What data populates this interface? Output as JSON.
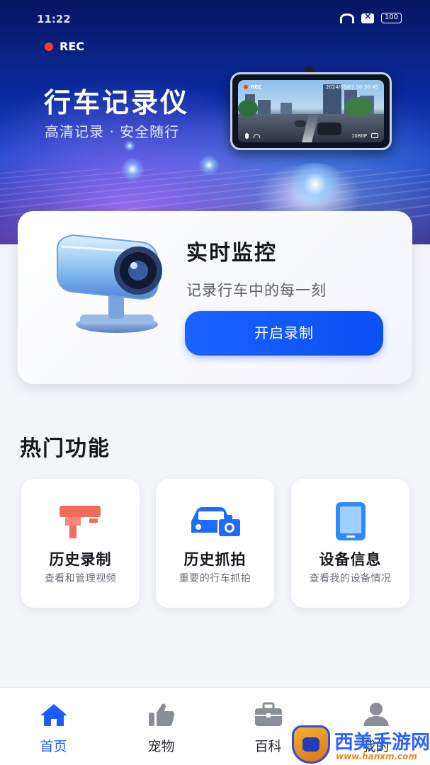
{
  "status_bar": {
    "time": "11:22",
    "battery": "100"
  },
  "hero": {
    "rec_label": "REC",
    "title": "行车记录仪",
    "subtitle": "高清记录 · 安全随行",
    "device_screen": {
      "rec_label": "REC",
      "datetime": "2024/06/01  10:30:45",
      "resolution": "1080P"
    }
  },
  "monitor_card": {
    "title": "实时监控",
    "description": "记录行车中的每一刻",
    "button_label": "开启录制"
  },
  "hot_features": {
    "title": "热门功能",
    "items": [
      {
        "name": "历史录制",
        "desc": "查看和管理视频",
        "icon": "cctv-camera-icon"
      },
      {
        "name": "历史抓拍",
        "desc": "重要的行车抓拍",
        "icon": "car-camera-icon"
      },
      {
        "name": "设备信息",
        "desc": "查看我的设备情况",
        "icon": "phone-device-icon"
      }
    ]
  },
  "tab_bar": {
    "tabs": [
      {
        "label": "首页",
        "icon": "home-icon",
        "active": true
      },
      {
        "label": "宠物",
        "icon": "thumbs-up-icon",
        "active": false
      },
      {
        "label": "百科",
        "icon": "briefcase-icon",
        "active": false
      },
      {
        "label": "我的",
        "icon": "user-icon",
        "active": false
      }
    ]
  },
  "watermark": {
    "text": "西美手游网",
    "url": "www.hanxm.com"
  },
  "colors": {
    "accent": "#1a5cff",
    "rec_red": "#ff3b30",
    "icon_coral": "#f26b5b",
    "icon_blue": "#1f6bff"
  }
}
